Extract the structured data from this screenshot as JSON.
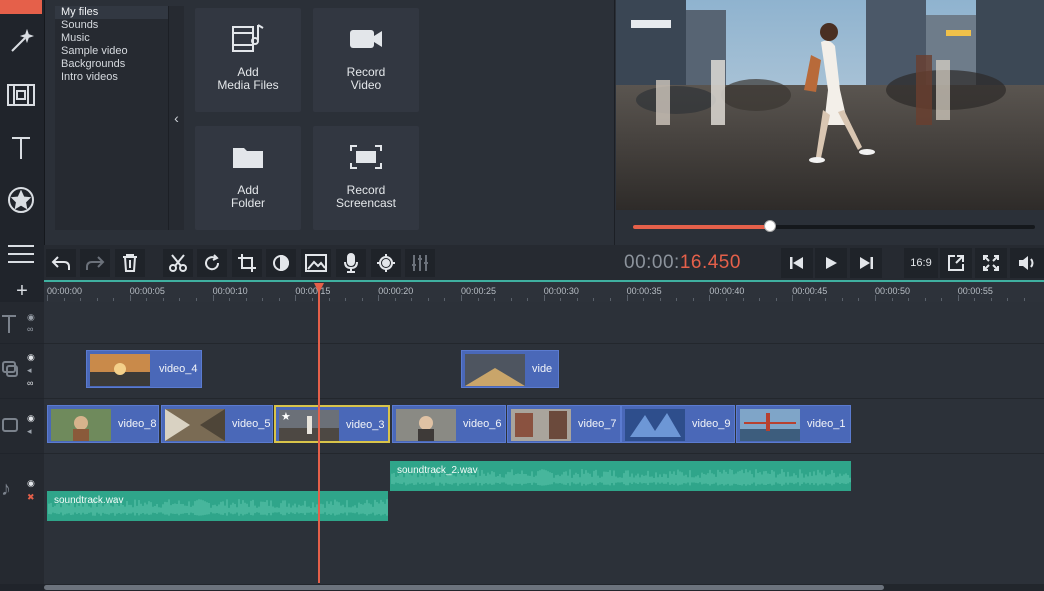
{
  "left_toolbar": {
    "items": [
      "import-tab",
      "magic-wand-icon",
      "film-icon",
      "title-icon",
      "sticker-icon",
      "list-icon"
    ]
  },
  "file_list": {
    "items": [
      "My files",
      "Sounds",
      "Music",
      "Sample video",
      "Backgrounds",
      "Intro videos"
    ],
    "active_index": 0
  },
  "tiles": {
    "add_media": "Add\nMedia Files",
    "record_video": "Record\nVideo",
    "add_folder": "Add\nFolder",
    "record_screencast": "Record\nScreencast"
  },
  "player": {
    "timecode_main": "00:00:",
    "timecode_accent": "16.450",
    "aspect_label": "16:9",
    "progress": 0.34
  },
  "ruler": {
    "labels": [
      "00:00:00",
      "00:00:05",
      "00:00:10",
      "00:00:15",
      "00:00:20",
      "00:00:25",
      "00:00:30",
      "00:00:35",
      "00:00:40",
      "00:00:45",
      "00:00:50",
      "00:00:55"
    ]
  },
  "timeline": {
    "overlay_clips": [
      {
        "label": "video_4"
      },
      {
        "label": "vide"
      }
    ],
    "main_clips": [
      {
        "label": "video_8"
      },
      {
        "label": "video_5"
      },
      {
        "label": "video_3"
      },
      {
        "label": "video_6"
      },
      {
        "label": "video_7"
      },
      {
        "label": "video_9"
      },
      {
        "label": "video_1"
      }
    ],
    "audio_clips": [
      {
        "label": "soundtrack_2.wav"
      },
      {
        "label": "soundtrack.wav"
      }
    ]
  },
  "colors": {
    "accent": "#e5604a",
    "clip_blue": "#4a68b8",
    "audio_green": "#2fa58a",
    "selected_clip": "#d9c44a"
  }
}
